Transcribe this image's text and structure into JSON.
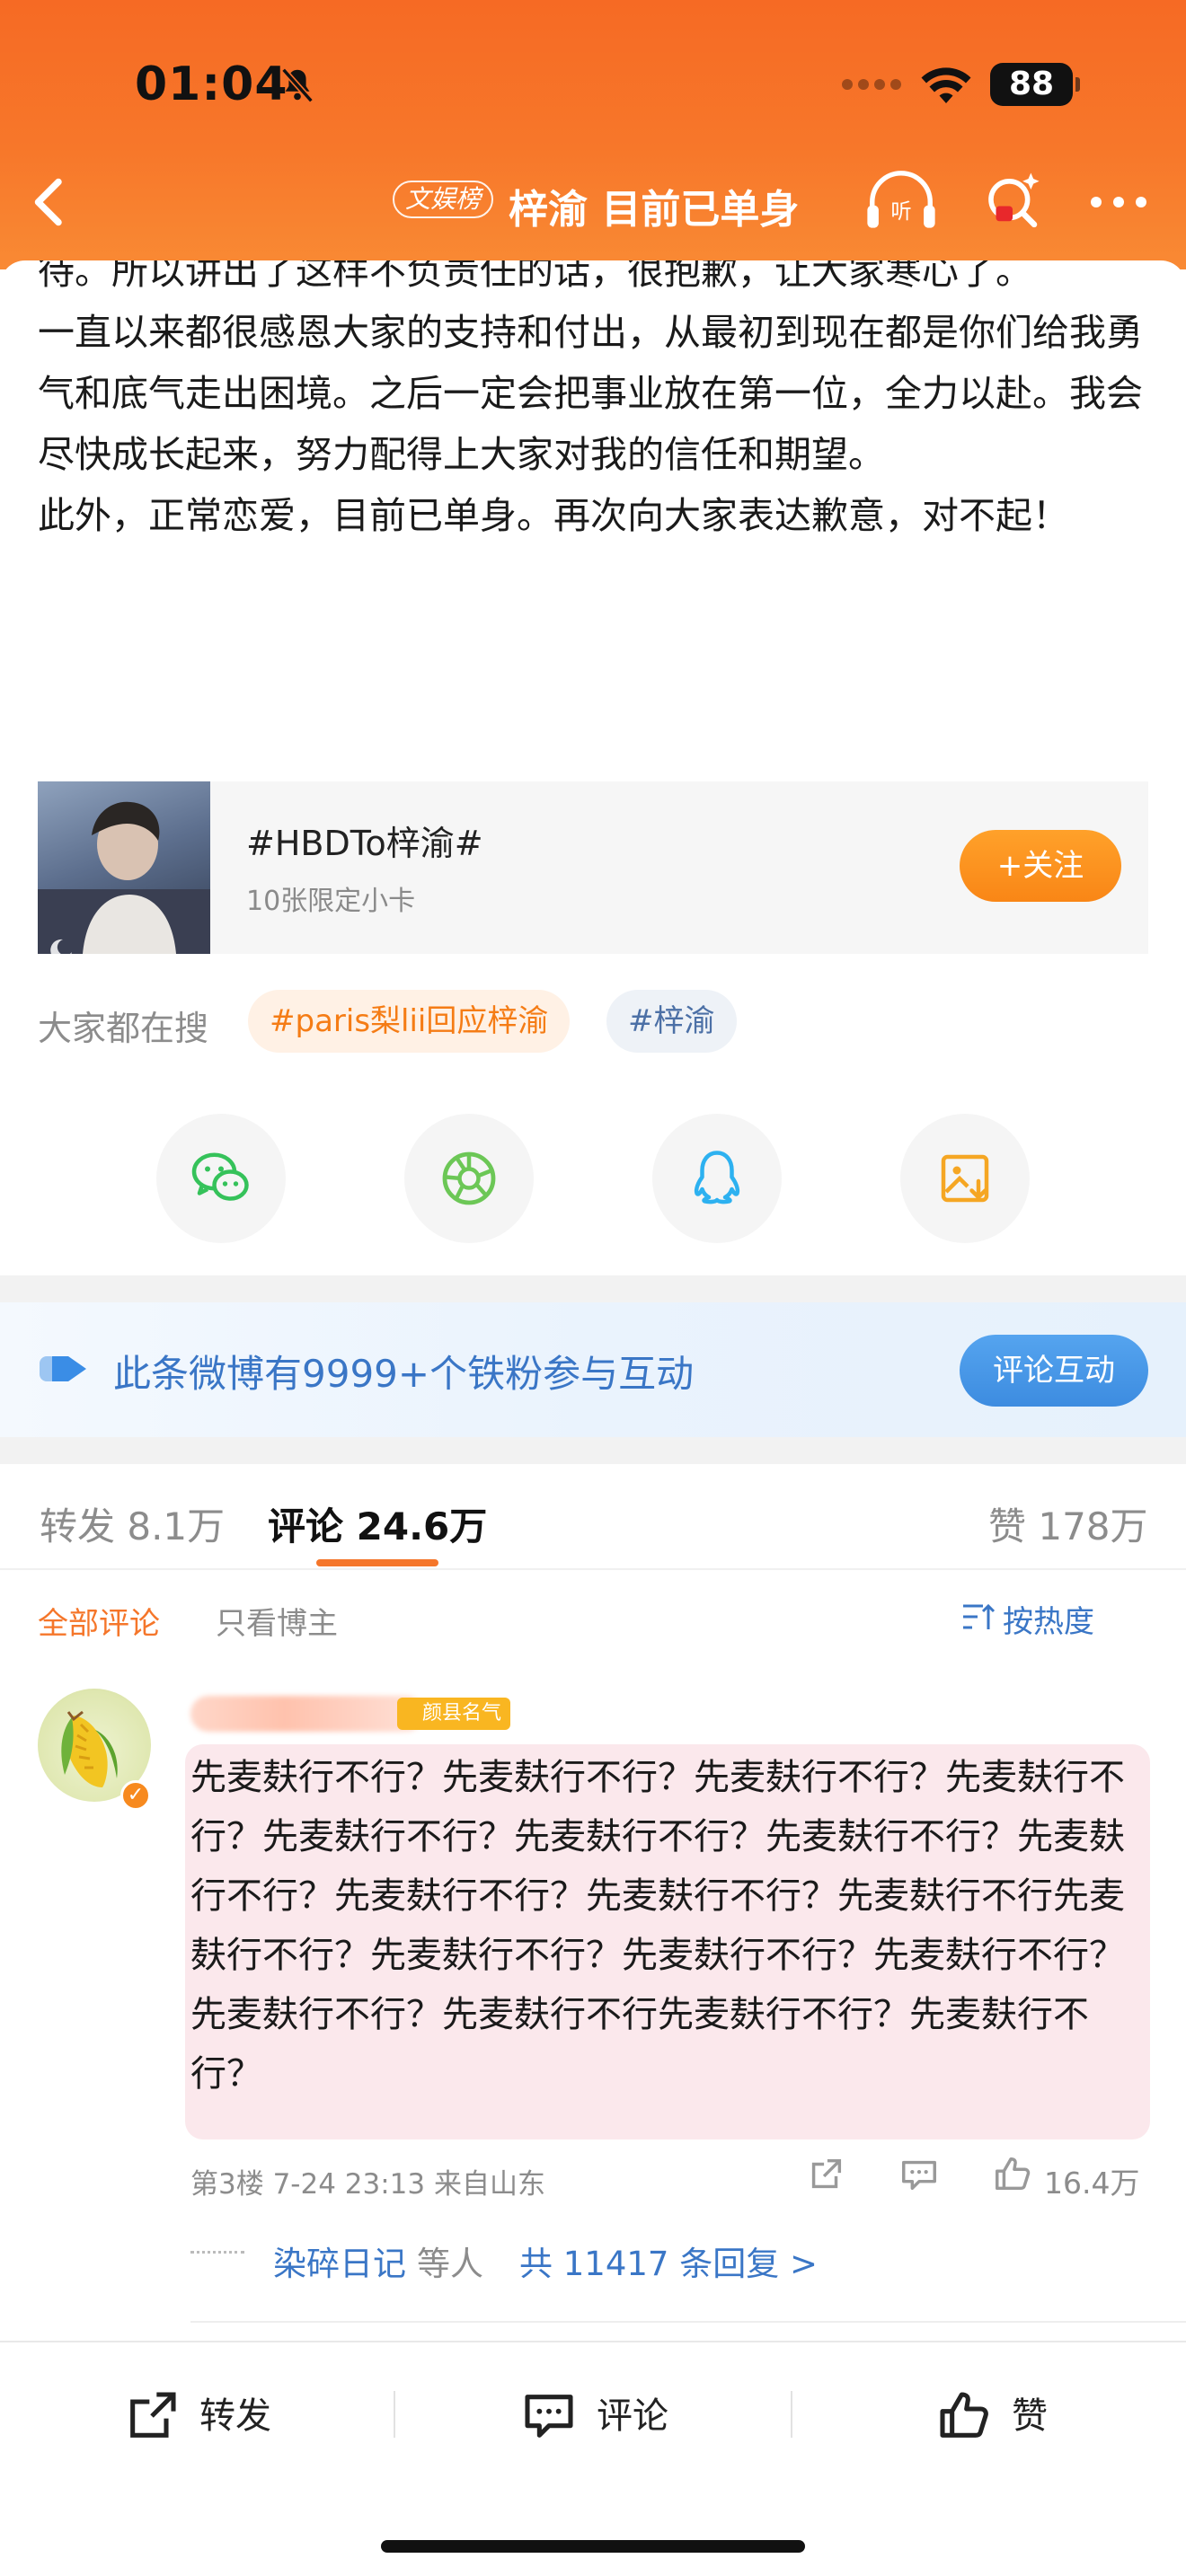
{
  "status_bar": {
    "time": "01:04",
    "battery": "88"
  },
  "nav": {
    "tag": "文娱榜",
    "title": "梓渝 目前已单身"
  },
  "post": {
    "paragraphs": [
      "待。所以讲出了这样不负责任的话，很抱歉，让大家寒心了。",
      "一直以来都很感恩大家的支持和付出，从最初到现在都是你们给我勇气和底气走出困境。之后一定会把事业放在第一位，全力以赴。我会尽快成长起来，努力配得上大家对我的信任和期望。",
      "此外，正常恋爱，目前已单身。再次向大家表达歉意，对不起！"
    ]
  },
  "topic_card": {
    "title": "#HBDTo梓渝#",
    "subtitle": "10张限定小卡",
    "follow_label": "+关注"
  },
  "hot_search": {
    "label": "大家都在搜",
    "chips": [
      "#paris梨lii回应梓渝",
      "#梓渝"
    ]
  },
  "share_icons": [
    "wechat-icon",
    "moments-icon",
    "qq-icon",
    "save-image-icon"
  ],
  "fans_banner": {
    "text": "此条微博有9999+个铁粉参与互动",
    "button": "评论互动"
  },
  "tabs": {
    "repost": "转发 8.1万",
    "comments": "评论 24.6万",
    "likes": "赞 178万"
  },
  "filter": {
    "all": "全部评论",
    "owner_only": "只看博主",
    "sort": "按热度"
  },
  "comment": {
    "badge": "颜县名气",
    "text": "先麦麸行不行？先麦麸行不行？先麦麸行不行？先麦麸行不行？先麦麸行不行？先麦麸行不行？先麦麸行不行？先麦麸行不行？先麦麸行不行？先麦麸行不行？先麦麸行不行先麦麸行不行？先麦麸行不行？先麦麸行不行？先麦麸行不行？先麦麸行不行？先麦麸行不行先麦麸行不行？先麦麸行不行？",
    "meta": "第3楼  7-24 23:13  来自山东",
    "likes": "16.4万",
    "reply_who": "染碎日记",
    "reply_deng": "等人",
    "reply_total": "共 11417 条回复 >"
  },
  "bottom_bar": {
    "repost": "转发",
    "comment": "评论",
    "like": "赞"
  },
  "colors": {
    "header_orange": "#f66a24",
    "accent_orange": "#f5762a",
    "link_blue": "#3a76c6"
  }
}
